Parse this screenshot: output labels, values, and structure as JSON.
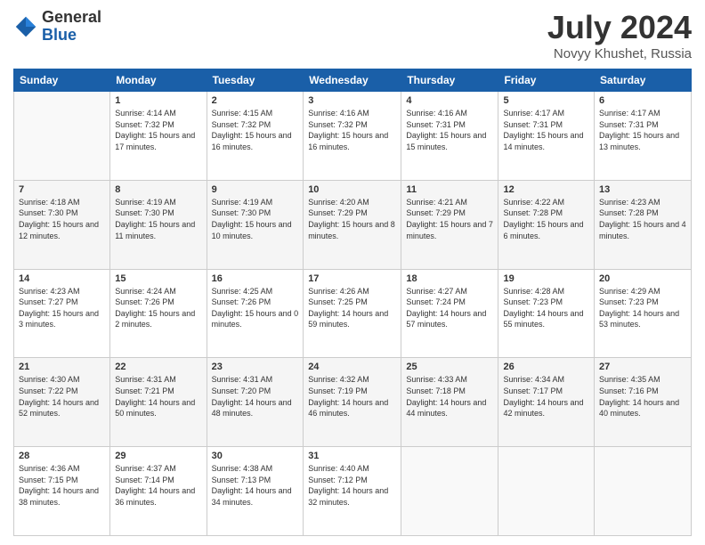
{
  "logo": {
    "general": "General",
    "blue": "Blue"
  },
  "header": {
    "month": "July 2024",
    "location": "Novyy Khushet, Russia"
  },
  "weekdays": [
    "Sunday",
    "Monday",
    "Tuesday",
    "Wednesday",
    "Thursday",
    "Friday",
    "Saturday"
  ],
  "weeks": [
    [
      {
        "day": "",
        "sunrise": "",
        "sunset": "",
        "daylight": ""
      },
      {
        "day": "1",
        "sunrise": "Sunrise: 4:14 AM",
        "sunset": "Sunset: 7:32 PM",
        "daylight": "Daylight: 15 hours and 17 minutes."
      },
      {
        "day": "2",
        "sunrise": "Sunrise: 4:15 AM",
        "sunset": "Sunset: 7:32 PM",
        "daylight": "Daylight: 15 hours and 16 minutes."
      },
      {
        "day": "3",
        "sunrise": "Sunrise: 4:16 AM",
        "sunset": "Sunset: 7:32 PM",
        "daylight": "Daylight: 15 hours and 16 minutes."
      },
      {
        "day": "4",
        "sunrise": "Sunrise: 4:16 AM",
        "sunset": "Sunset: 7:31 PM",
        "daylight": "Daylight: 15 hours and 15 minutes."
      },
      {
        "day": "5",
        "sunrise": "Sunrise: 4:17 AM",
        "sunset": "Sunset: 7:31 PM",
        "daylight": "Daylight: 15 hours and 14 minutes."
      },
      {
        "day": "6",
        "sunrise": "Sunrise: 4:17 AM",
        "sunset": "Sunset: 7:31 PM",
        "daylight": "Daylight: 15 hours and 13 minutes."
      }
    ],
    [
      {
        "day": "7",
        "sunrise": "Sunrise: 4:18 AM",
        "sunset": "Sunset: 7:30 PM",
        "daylight": "Daylight: 15 hours and 12 minutes."
      },
      {
        "day": "8",
        "sunrise": "Sunrise: 4:19 AM",
        "sunset": "Sunset: 7:30 PM",
        "daylight": "Daylight: 15 hours and 11 minutes."
      },
      {
        "day": "9",
        "sunrise": "Sunrise: 4:19 AM",
        "sunset": "Sunset: 7:30 PM",
        "daylight": "Daylight: 15 hours and 10 minutes."
      },
      {
        "day": "10",
        "sunrise": "Sunrise: 4:20 AM",
        "sunset": "Sunset: 7:29 PM",
        "daylight": "Daylight: 15 hours and 8 minutes."
      },
      {
        "day": "11",
        "sunrise": "Sunrise: 4:21 AM",
        "sunset": "Sunset: 7:29 PM",
        "daylight": "Daylight: 15 hours and 7 minutes."
      },
      {
        "day": "12",
        "sunrise": "Sunrise: 4:22 AM",
        "sunset": "Sunset: 7:28 PM",
        "daylight": "Daylight: 15 hours and 6 minutes."
      },
      {
        "day": "13",
        "sunrise": "Sunrise: 4:23 AM",
        "sunset": "Sunset: 7:28 PM",
        "daylight": "Daylight: 15 hours and 4 minutes."
      }
    ],
    [
      {
        "day": "14",
        "sunrise": "Sunrise: 4:23 AM",
        "sunset": "Sunset: 7:27 PM",
        "daylight": "Daylight: 15 hours and 3 minutes."
      },
      {
        "day": "15",
        "sunrise": "Sunrise: 4:24 AM",
        "sunset": "Sunset: 7:26 PM",
        "daylight": "Daylight: 15 hours and 2 minutes."
      },
      {
        "day": "16",
        "sunrise": "Sunrise: 4:25 AM",
        "sunset": "Sunset: 7:26 PM",
        "daylight": "Daylight: 15 hours and 0 minutes."
      },
      {
        "day": "17",
        "sunrise": "Sunrise: 4:26 AM",
        "sunset": "Sunset: 7:25 PM",
        "daylight": "Daylight: 14 hours and 59 minutes."
      },
      {
        "day": "18",
        "sunrise": "Sunrise: 4:27 AM",
        "sunset": "Sunset: 7:24 PM",
        "daylight": "Daylight: 14 hours and 57 minutes."
      },
      {
        "day": "19",
        "sunrise": "Sunrise: 4:28 AM",
        "sunset": "Sunset: 7:23 PM",
        "daylight": "Daylight: 14 hours and 55 minutes."
      },
      {
        "day": "20",
        "sunrise": "Sunrise: 4:29 AM",
        "sunset": "Sunset: 7:23 PM",
        "daylight": "Daylight: 14 hours and 53 minutes."
      }
    ],
    [
      {
        "day": "21",
        "sunrise": "Sunrise: 4:30 AM",
        "sunset": "Sunset: 7:22 PM",
        "daylight": "Daylight: 14 hours and 52 minutes."
      },
      {
        "day": "22",
        "sunrise": "Sunrise: 4:31 AM",
        "sunset": "Sunset: 7:21 PM",
        "daylight": "Daylight: 14 hours and 50 minutes."
      },
      {
        "day": "23",
        "sunrise": "Sunrise: 4:31 AM",
        "sunset": "Sunset: 7:20 PM",
        "daylight": "Daylight: 14 hours and 48 minutes."
      },
      {
        "day": "24",
        "sunrise": "Sunrise: 4:32 AM",
        "sunset": "Sunset: 7:19 PM",
        "daylight": "Daylight: 14 hours and 46 minutes."
      },
      {
        "day": "25",
        "sunrise": "Sunrise: 4:33 AM",
        "sunset": "Sunset: 7:18 PM",
        "daylight": "Daylight: 14 hours and 44 minutes."
      },
      {
        "day": "26",
        "sunrise": "Sunrise: 4:34 AM",
        "sunset": "Sunset: 7:17 PM",
        "daylight": "Daylight: 14 hours and 42 minutes."
      },
      {
        "day": "27",
        "sunrise": "Sunrise: 4:35 AM",
        "sunset": "Sunset: 7:16 PM",
        "daylight": "Daylight: 14 hours and 40 minutes."
      }
    ],
    [
      {
        "day": "28",
        "sunrise": "Sunrise: 4:36 AM",
        "sunset": "Sunset: 7:15 PM",
        "daylight": "Daylight: 14 hours and 38 minutes."
      },
      {
        "day": "29",
        "sunrise": "Sunrise: 4:37 AM",
        "sunset": "Sunset: 7:14 PM",
        "daylight": "Daylight: 14 hours and 36 minutes."
      },
      {
        "day": "30",
        "sunrise": "Sunrise: 4:38 AM",
        "sunset": "Sunset: 7:13 PM",
        "daylight": "Daylight: 14 hours and 34 minutes."
      },
      {
        "day": "31",
        "sunrise": "Sunrise: 4:40 AM",
        "sunset": "Sunset: 7:12 PM",
        "daylight": "Daylight: 14 hours and 32 minutes."
      },
      {
        "day": "",
        "sunrise": "",
        "sunset": "",
        "daylight": ""
      },
      {
        "day": "",
        "sunrise": "",
        "sunset": "",
        "daylight": ""
      },
      {
        "day": "",
        "sunrise": "",
        "sunset": "",
        "daylight": ""
      }
    ]
  ]
}
